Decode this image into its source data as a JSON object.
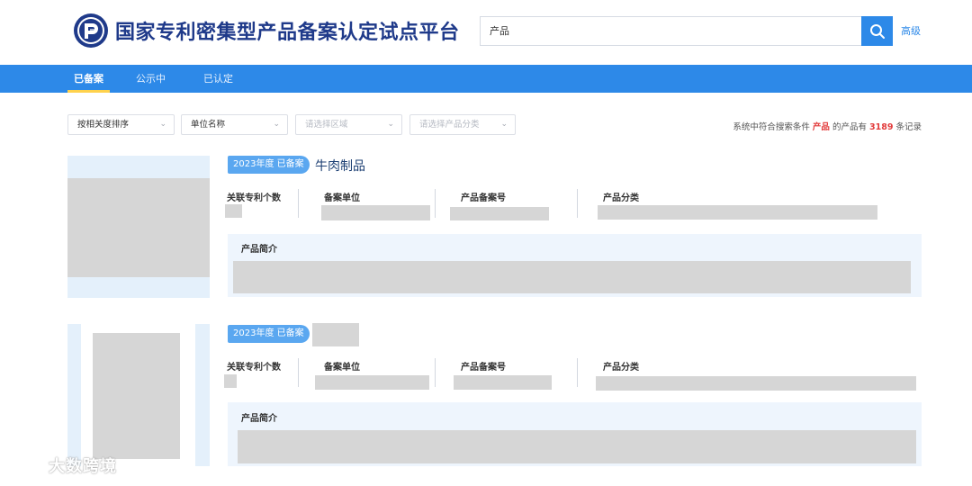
{
  "header": {
    "site_title": "国家专利密集型产品备案认定试点平台",
    "search_value": "产品",
    "advanced_label": "高级"
  },
  "nav": {
    "tabs": [
      {
        "label": "已备案",
        "active": true
      },
      {
        "label": "公示中",
        "active": false
      },
      {
        "label": "已认定",
        "active": false
      }
    ]
  },
  "filters": {
    "sort": "按相关度排序",
    "unit": "单位名称",
    "region_placeholder": "请选择区域",
    "category_placeholder": "请选择产品分类"
  },
  "summary": {
    "prefix": "系统中符合搜索条件",
    "keyword": "产品",
    "middle": "的产品有",
    "count": "3189",
    "suffix": "条记录"
  },
  "cards": [
    {
      "badge": "2023年度 已备案",
      "name": "牛肉制品",
      "labels": {
        "patents": "关联专利个数",
        "unit": "备案单位",
        "record_no": "产品备案号",
        "category": "产品分类",
        "intro": "产品简介"
      }
    },
    {
      "badge": "2023年度 已备案",
      "name": "",
      "labels": {
        "patents": "关联专利个数",
        "unit": "备案单位",
        "record_no": "产品备案号",
        "category": "产品分类",
        "intro": "产品简介"
      }
    }
  ],
  "watermark": "大数跨境",
  "colors": {
    "primary": "#2d89e8",
    "title": "#1f3a8a",
    "highlight": "#e23b3b",
    "badge": "#5aa7f0"
  }
}
